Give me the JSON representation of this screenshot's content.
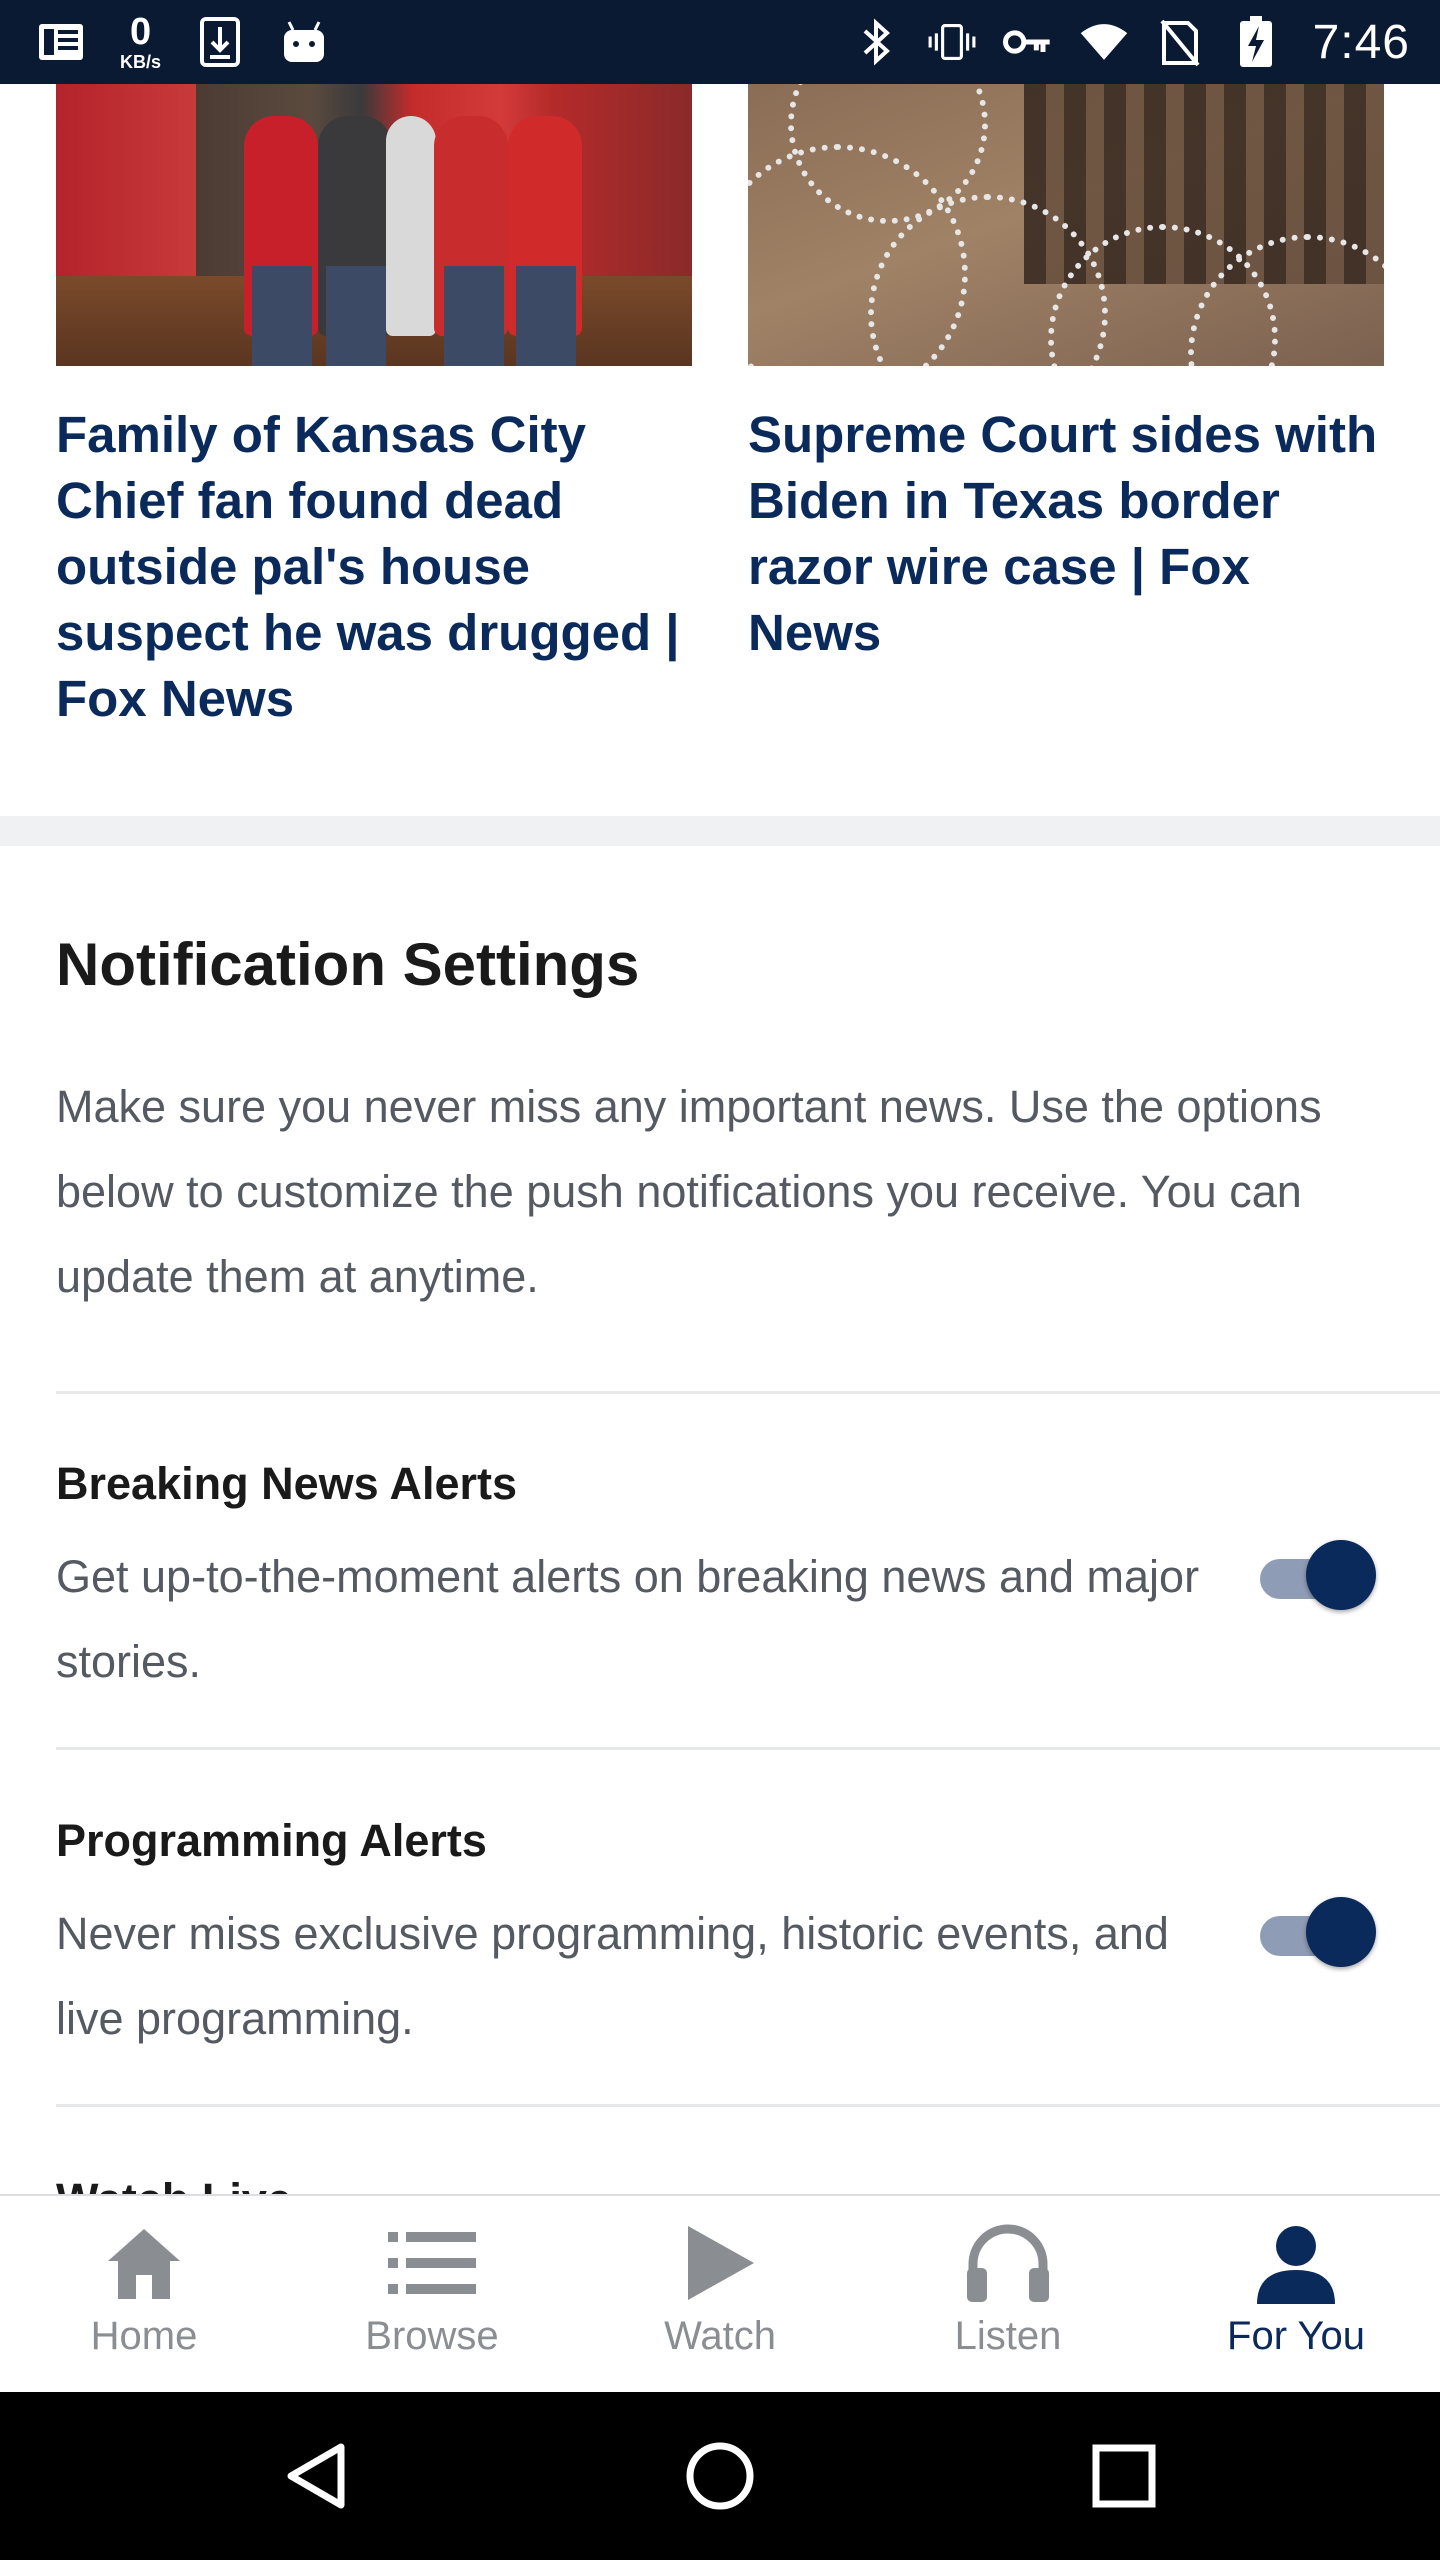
{
  "status_bar": {
    "net_speed_value": "0",
    "net_speed_unit": "KB/s",
    "time": "7:46",
    "icons_left": [
      "news-app-icon",
      "download-icon",
      "android-icon"
    ],
    "icons_right": [
      "bluetooth-icon",
      "vibrate-icon",
      "vpn-key-icon",
      "wifi-icon",
      "no-sim-icon",
      "battery-charging-icon"
    ]
  },
  "articles": [
    {
      "title": "Family of Kansas City Chief fan found dead outside pal's house suspect he was drugged | Fox News"
    },
    {
      "title": "Supreme Court sides with Biden in Texas border razor wire case | Fox News"
    }
  ],
  "notification_settings": {
    "title": "Notification Settings",
    "description": "Make sure you never miss any important news. Use the options below to customize the push notifications you receive. You can update them at anytime.",
    "items": [
      {
        "title": "Breaking News Alerts",
        "description": "Get up-to-the-moment alerts on breaking news and major stories.",
        "enabled": true
      },
      {
        "title": "Programming Alerts",
        "description": "Never miss exclusive programming, historic events, and live programming.",
        "enabled": true
      },
      {
        "title": "Watch Live"
      }
    ]
  },
  "bottom_nav": {
    "items": [
      {
        "label": "Home",
        "icon": "home-icon"
      },
      {
        "label": "Browse",
        "icon": "list-icon"
      },
      {
        "label": "Watch",
        "icon": "play-icon"
      },
      {
        "label": "Listen",
        "icon": "headphones-icon"
      },
      {
        "label": "For You",
        "icon": "person-icon"
      }
    ],
    "active": "For You"
  },
  "colors": {
    "brand_navy": "#0b2a5c",
    "status_bar": "#0b1a33",
    "inactive_nav": "#8a8d92",
    "toggle_track": "#8f9cb5"
  }
}
